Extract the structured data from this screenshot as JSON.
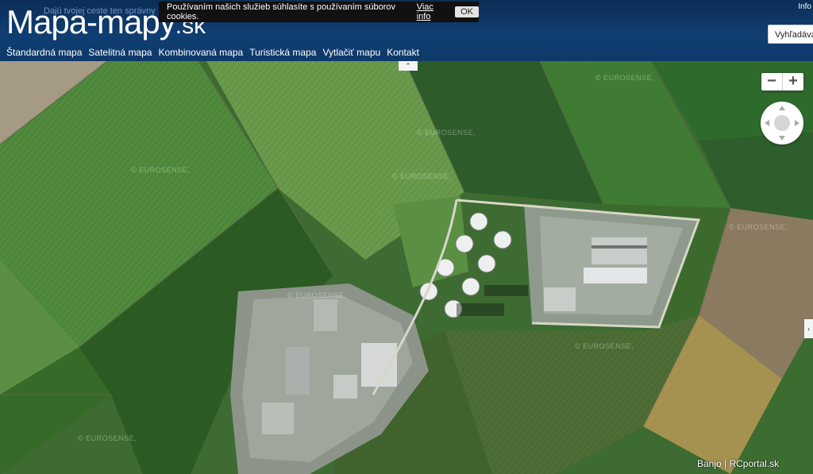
{
  "header": {
    "logo_main": "Mapa-mapy",
    "logo_tld": ".sk",
    "tagline": "Dajú tvojej ceste ten správny",
    "info_link": "Info",
    "search_label": "Vyhľadáva",
    "nav": [
      {
        "label": "Štandardná mapa"
      },
      {
        "label": "Satelitná mapa"
      },
      {
        "label": "Kombinovaná mapa"
      },
      {
        "label": "Turistická mapa"
      },
      {
        "label": "Vytlačiť mapu"
      },
      {
        "label": "Kontakt"
      }
    ]
  },
  "cookie": {
    "text": "Používaním našich služieb súhlasíte s používaním súborov cookies.",
    "more_label": "Viac info",
    "ok_label": "OK"
  },
  "map": {
    "watermark": "© EUROSENSE,",
    "credit": "Banjo | RCportal.sk",
    "zoom_out": "−",
    "zoom_in": "+",
    "collapse_icon": "double-chevron-up",
    "side_icon": "double-chevron-right"
  }
}
